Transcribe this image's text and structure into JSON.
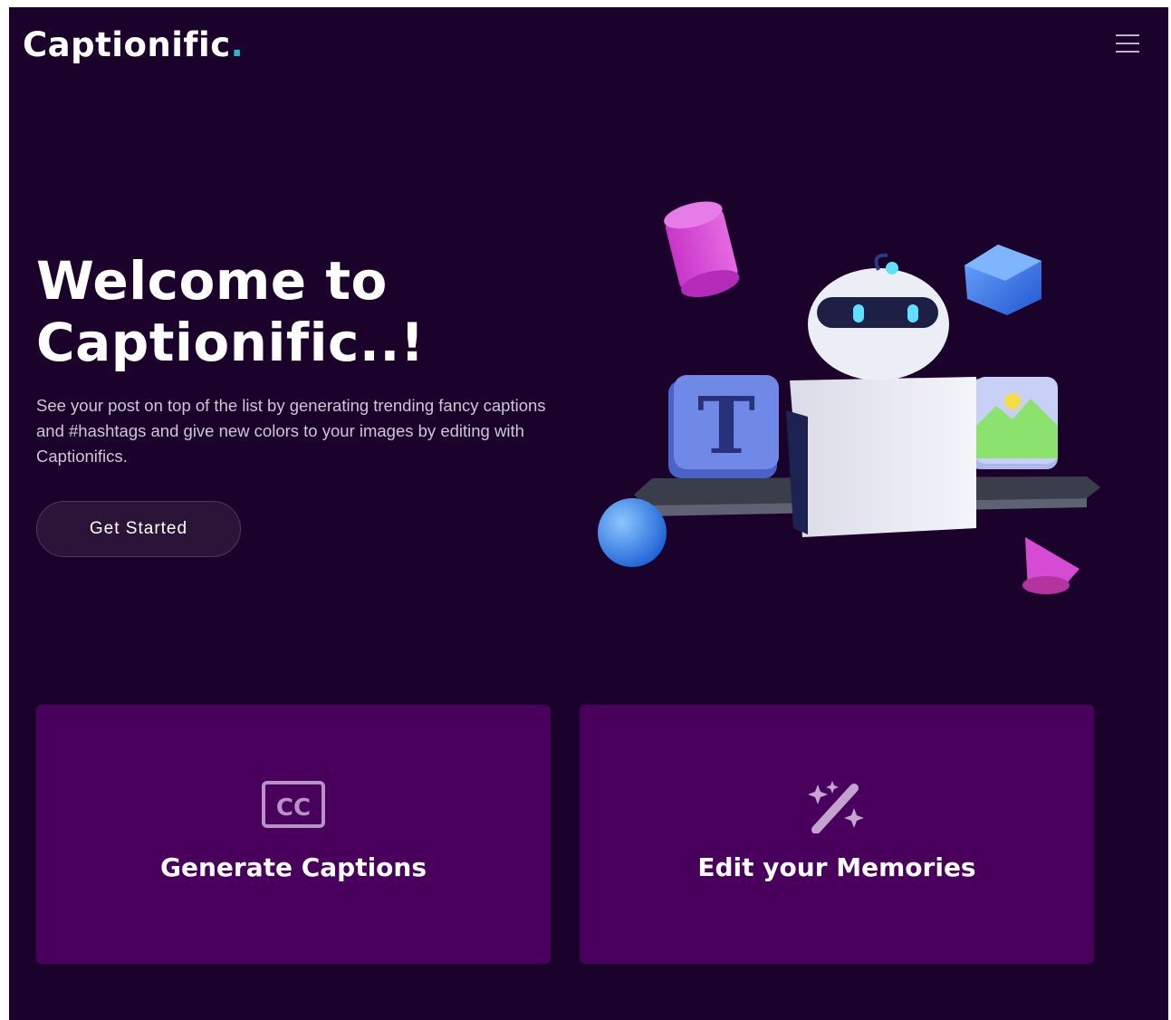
{
  "header": {
    "brand": "Captionific",
    "brand_dot": ".",
    "menu_icon": "hamburger-menu-icon"
  },
  "hero": {
    "title": "Welcome to Captionific..!",
    "description": "See your post on top of the list by generating trending fancy captions and #hashtags and give new colors to your images by editing with Captionifics.",
    "cta_label": "Get Started",
    "illustration": "robot-illustration"
  },
  "features": [
    {
      "label": "Generate Captions",
      "icon": "closed-captions-icon"
    },
    {
      "label": "Edit your Memories",
      "icon": "magic-wand-icon"
    }
  ],
  "colors": {
    "background": "#1b022b",
    "card": "#48005c",
    "accent": "#29b6c9",
    "button": "#2c1439"
  }
}
